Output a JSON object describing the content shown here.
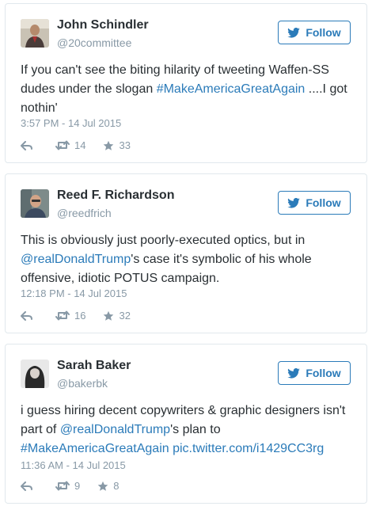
{
  "accent": "#2b7bb9",
  "muted": "#8899a6",
  "follow_label": "Follow",
  "tweets": [
    {
      "name": "John Schindler",
      "handle": "@20committee",
      "text_parts": [
        {
          "t": "If you can't see the biting hilarity of tweeting Waffen-SS dudes under the slogan ",
          "link": false
        },
        {
          "t": "#MakeAmericaGreatAgain",
          "link": true
        },
        {
          "t": " ....I got nothin'",
          "link": false
        }
      ],
      "timestamp": "3:57 PM - 14 Jul 2015",
      "retweets": "14",
      "likes": "33",
      "avatar_icon": "avatar-photo-icon"
    },
    {
      "name": "Reed F. Richardson",
      "handle": "@reedfrich",
      "text_parts": [
        {
          "t": "This is obviously just poorly-executed optics, but in ",
          "link": false
        },
        {
          "t": "@realDonaldTrump",
          "link": true
        },
        {
          "t": "'s case it's symbolic of his whole offensive, idiotic POTUS campaign.",
          "link": false
        }
      ],
      "timestamp": "12:18 PM - 14 Jul 2015",
      "retweets": "16",
      "likes": "32",
      "avatar_icon": "avatar-photo-icon"
    },
    {
      "name": "Sarah Baker",
      "handle": "@bakerbk",
      "text_parts": [
        {
          "t": "i guess hiring decent copywriters & graphic designers isn't part of ",
          "link": false
        },
        {
          "t": "@realDonaldTrump",
          "link": true
        },
        {
          "t": "'s plan to ",
          "link": false
        },
        {
          "t": "#MakeAmericaGreatAgain",
          "link": true
        },
        {
          "t": " ",
          "link": false
        },
        {
          "t": "pic.twitter.com/i1429CC3rg",
          "link": true
        }
      ],
      "timestamp": "11:36 AM - 14 Jul 2015",
      "retweets": "9",
      "likes": "8",
      "avatar_icon": "avatar-photo-icon"
    }
  ]
}
